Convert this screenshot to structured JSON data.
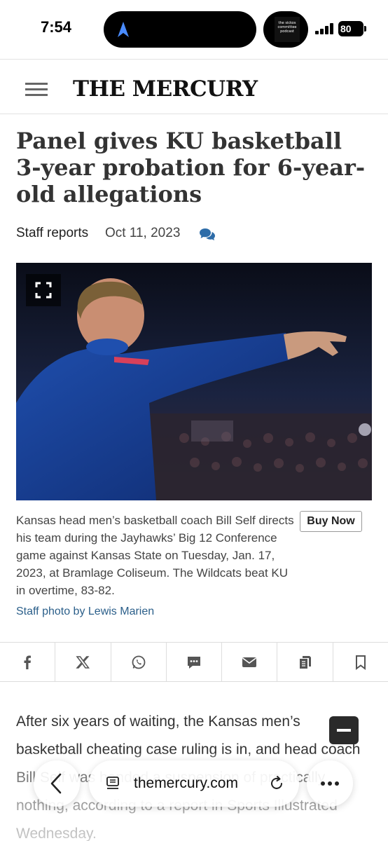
{
  "status_bar": {
    "time": "7:54",
    "podcast_art_text": "the sickos committee podcast",
    "battery": "80"
  },
  "header": {
    "logo": "THE MERCURY"
  },
  "article": {
    "headline": "Panel gives KU basketball 3-year probation for 6-year-old allegations",
    "byline": "Staff reports",
    "date": "Oct 11, 2023",
    "caption": "Kansas head men’s basketball coach Bill Self directs his team during the Jayhawks’ Big 12 Conference game against Kansas State on Tuesday, Jan. 17, 2023, at Bramlage Coliseum. The Wildcats beat KU in overtime, 83-82.",
    "buy_now_label": "Buy Now",
    "photo_credit": "Staff photo by Lewis Marien",
    "body": "After six years of waiting, the Kansas men’s basketball cheating case ruling is in, and head coach Bill Self was handed a suspension of practically nothing, according to a report in Sports Illustrated Wednesday."
  },
  "share": [
    "facebook-icon",
    "x-icon",
    "whatsapp-icon",
    "sms-icon",
    "email-icon",
    "copy-icon",
    "bookmark-icon"
  ],
  "browser": {
    "url": "themercury.com"
  }
}
